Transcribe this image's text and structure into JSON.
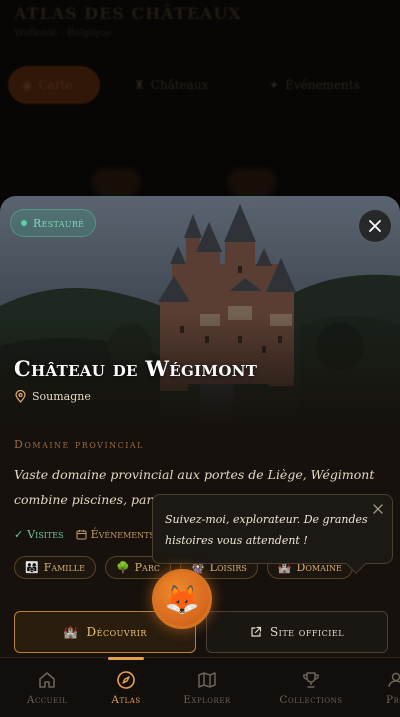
{
  "background": {
    "title": "ATLAS DES CHÂTEAUX",
    "subtitle": "Wallonie · Belgique",
    "subtitle2": "",
    "chips": [
      {
        "label": "Carte",
        "icon": "globe-icon"
      },
      {
        "label": "Châteaux",
        "icon": "castle-icon"
      },
      {
        "label": "Événements",
        "icon": "star-icon"
      }
    ]
  },
  "card": {
    "status": "Restauré",
    "title": "Château de Wégimont",
    "location": "Soumagne",
    "category": "Domaine provincial",
    "description": "Vaste domaine provincial aux portes de Liège, Wégimont combine piscines, parcs et architecture...",
    "meta": {
      "visites": "Visites",
      "events": "Événements"
    },
    "tags": [
      {
        "label": "Famille",
        "emoji": "👨‍👩‍👧"
      },
      {
        "label": "Parc",
        "emoji": "🌳"
      },
      {
        "label": "Loisirs",
        "emoji": "🎡"
      },
      {
        "label": "Domaine",
        "emoji": "🏰"
      }
    ],
    "buttons": {
      "discover": "Découvrir",
      "discover_emoji": "🏰",
      "site": "Site officiel"
    }
  },
  "assistant": {
    "message": "Suivez-moi, explorateur. De grandes histoires vous attendent !",
    "avatar": "🦊"
  },
  "nav": {
    "items": [
      {
        "label": "Accueil",
        "icon": "home-icon"
      },
      {
        "label": "Atlas",
        "icon": "compass-icon",
        "active": true
      },
      {
        "label": "Explorer",
        "icon": "map-icon"
      },
      {
        "label": "Collections",
        "icon": "trophy-icon"
      },
      {
        "label": "Profil",
        "icon": "user-icon"
      }
    ]
  },
  "colors": {
    "accent": "#e8a04a",
    "status_green": "#58d4a4",
    "background": "#0b0907",
    "card": "#16110c"
  }
}
